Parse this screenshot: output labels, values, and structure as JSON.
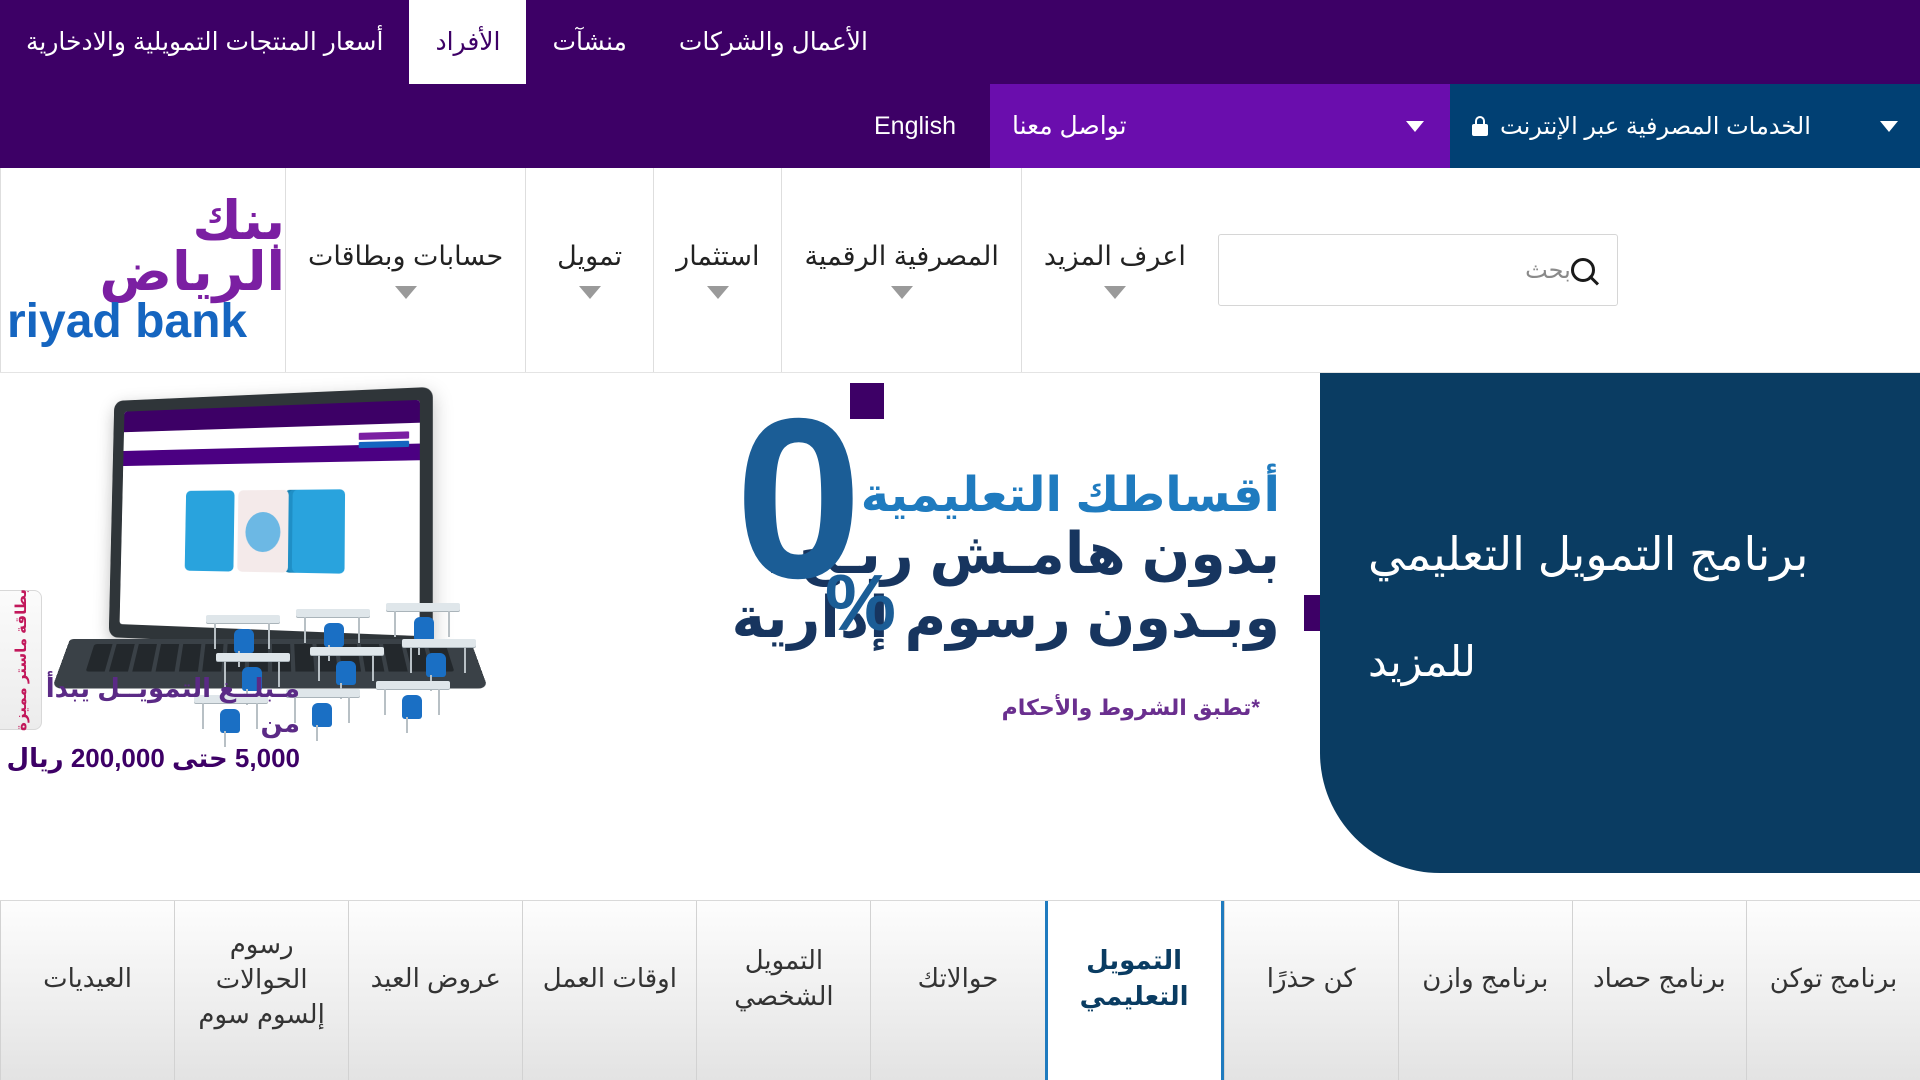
{
  "topbar": {
    "items": [
      {
        "label": "أسعار المنتجات التمويلية والادخارية",
        "active": false
      },
      {
        "label": "الأفراد",
        "active": true
      },
      {
        "label": "منشآت",
        "active": false
      },
      {
        "label": "الأعمال والشركات",
        "active": false
      }
    ]
  },
  "secondbar": {
    "online_banking_label": "الخدمات المصرفية عبر الإنترنت",
    "contact_label": "تواصل معنا",
    "english_label": "English",
    "lock_icon": "lock-icon",
    "chevron_icon": "chevron-down-icon"
  },
  "mainnav": {
    "logo_ar": "بنك الرياض",
    "logo_en": "riyad bank",
    "items": [
      {
        "label": "حسابات وبطاقات"
      },
      {
        "label": "تمويل"
      },
      {
        "label": "استثمار"
      },
      {
        "label": "المصرفية الرقمية"
      },
      {
        "label": "اعرف المزيد"
      }
    ],
    "search": {
      "placeholder": "بحث",
      "value": "",
      "icon": "search-icon"
    }
  },
  "hero": {
    "card_title": "برنامج التمويل التعليمي",
    "card_more": "للمزيد",
    "promo_line1": "أقساطك التعليمية",
    "promo_line2": "بدون هامـش ربـح..",
    "promo_line3": "وبـدون رسوم إدارية",
    "zero": "0",
    "percent": "%",
    "terms": "*تطبق الشروط والأحكام",
    "amount_line1": "مـبلــغ التمويــل يبدأ من",
    "amount_line2": "5,000 حتى 200,000 ريال",
    "sidetab_label": "بطاقة ماستر مميزة"
  },
  "tabstrip": {
    "tabs": [
      {
        "label": "العيديات",
        "active": false,
        "overflow": false
      },
      {
        "label": "رسوم الحوالات إلسوم سوم",
        "active": false,
        "overflow": true
      },
      {
        "label": "عروض العيد",
        "active": false,
        "overflow": false
      },
      {
        "label": "اوقات العمل",
        "active": false,
        "overflow": false
      },
      {
        "label": "التمويل الشخصي",
        "active": false,
        "overflow": false
      },
      {
        "label": "حوالاتك",
        "active": false,
        "overflow": false
      },
      {
        "label": "التمويل التعليمي",
        "active": true,
        "overflow": false
      },
      {
        "label": "كن حذرًا",
        "active": false,
        "overflow": false
      },
      {
        "label": "برنامج وازن",
        "active": false,
        "overflow": false
      },
      {
        "label": "برنامج حصاد",
        "active": false,
        "overflow": false
      },
      {
        "label": "برنامج توكن",
        "active": false,
        "overflow": false
      }
    ]
  },
  "colors": {
    "purple_dark": "#3d0066",
    "purple_mid": "#6a0dad",
    "navy": "#014073",
    "card_navy": "#0a3c62",
    "brand_blue": "#1565c0",
    "brand_purple": "#7b1fa2",
    "accent_blue": "#1f7bbf",
    "pink": "#c2185b"
  }
}
